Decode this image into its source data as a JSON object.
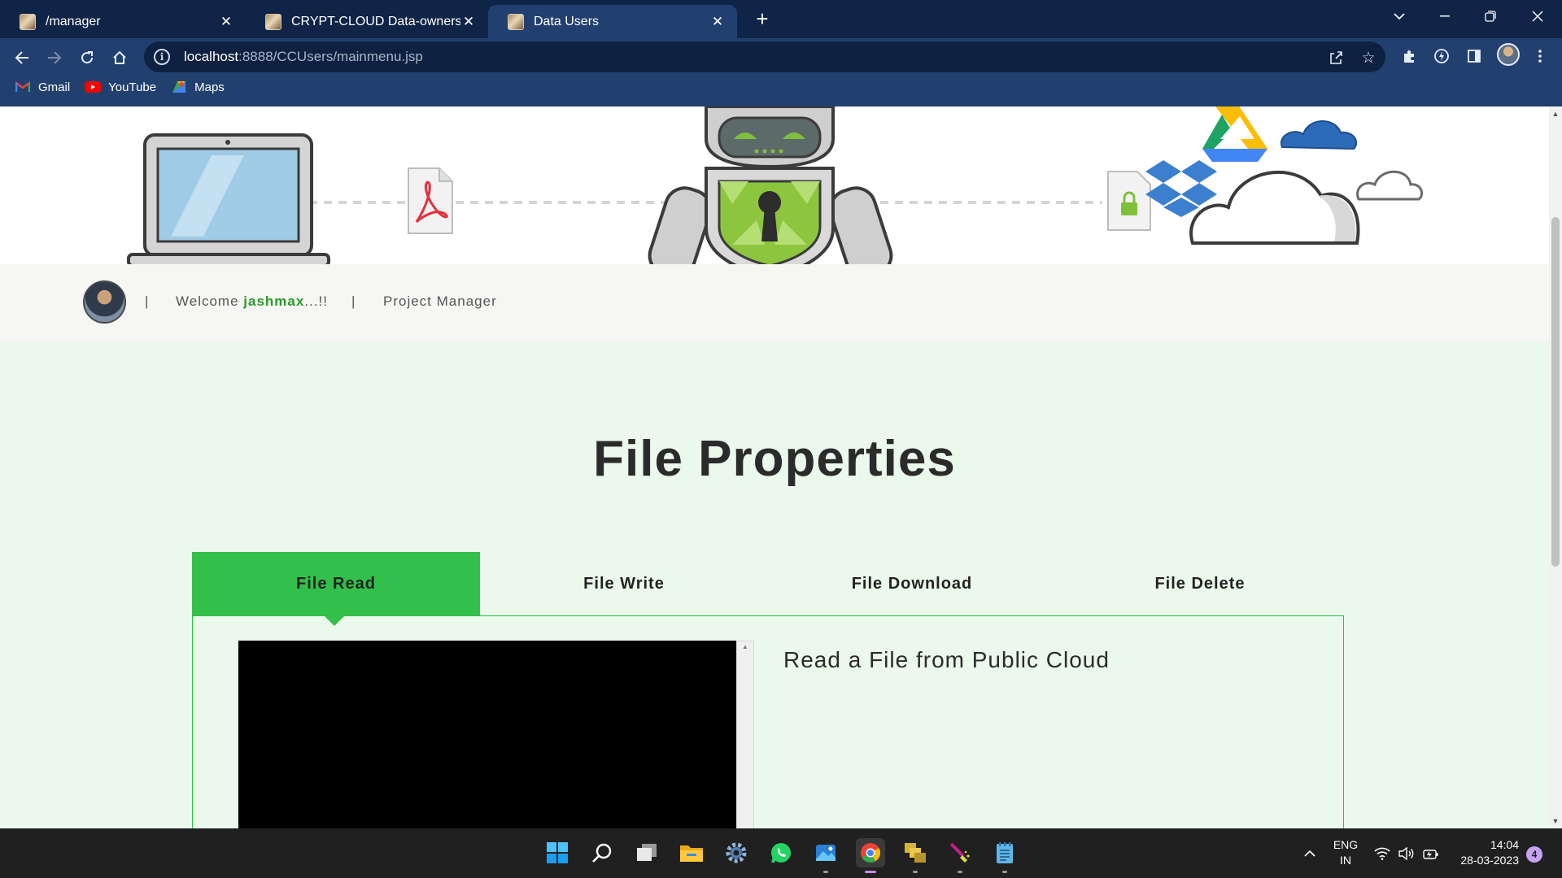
{
  "browser": {
    "tabs": [
      {
        "title": "/manager",
        "active": false
      },
      {
        "title": "CRYPT-CLOUD Data-owners",
        "active": false
      },
      {
        "title": "Data Users",
        "active": true
      }
    ],
    "new_tab_icon": "plus-icon",
    "window_controls": [
      "tab-search-icon",
      "minimize-icon",
      "restore-icon",
      "close-icon"
    ],
    "address": {
      "host": "localhost",
      "rest": ":8888/CCUsers/mainmenu.jsp"
    },
    "bookmarks": [
      {
        "label": "Gmail",
        "icon": "gmail-icon",
        "color": "#ea4335"
      },
      {
        "label": "YouTube",
        "icon": "youtube-icon",
        "color": "#ff0000"
      },
      {
        "label": "Maps",
        "icon": "maps-icon",
        "color": "#34a853"
      }
    ],
    "colors": {
      "tabstrip": "#0f2447",
      "toolbar": "#22406f"
    }
  },
  "page": {
    "user_bar": {
      "welcome_prefix": "Welcome ",
      "username": "jashmax",
      "welcome_suffix": "...!!",
      "separator": "|",
      "role": "Project Manager"
    },
    "title": "File Properties",
    "tabs": [
      {
        "label": "File Read",
        "active": true
      },
      {
        "label": "File Write",
        "active": false
      },
      {
        "label": "File Download",
        "active": false
      },
      {
        "label": "File Delete",
        "active": false
      }
    ],
    "panel": {
      "heading": "Read a File from Public Cloud"
    },
    "colors": {
      "accent": "#33bf4c",
      "background": "#ebf8ec",
      "username": "#2a9a2a"
    }
  },
  "taskbar": {
    "apps": [
      "windows-start-icon",
      "search-icon",
      "task-view-icon",
      "file-explorer-icon",
      "settings-icon",
      "whatsapp-icon",
      "photos-icon",
      "chrome-icon",
      "stacked-files-icon",
      "paint-brush-icon",
      "notepad-icon"
    ],
    "language": {
      "line1": "ENG",
      "line2": "IN"
    },
    "time": "14:04",
    "date": "28-03-2023",
    "notifications": "4"
  }
}
